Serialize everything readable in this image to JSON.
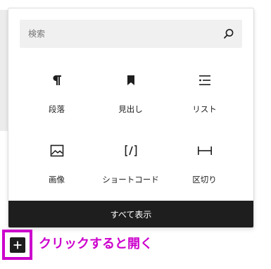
{
  "search": {
    "placeholder": "検索",
    "icon": "search-icon"
  },
  "blocks": [
    {
      "label": "段落",
      "icon": "paragraph-icon"
    },
    {
      "label": "見出し",
      "icon": "bookmark-icon"
    },
    {
      "label": "リスト",
      "icon": "list-icon"
    },
    {
      "label": "画像",
      "icon": "image-icon"
    },
    {
      "label": "ショートコード",
      "icon": "shortcode-icon"
    },
    {
      "label": "区切り",
      "icon": "separator-icon"
    }
  ],
  "footer": {
    "browse_all_label": "すべて表示"
  },
  "add_block": {
    "icon": "plus-icon",
    "highlight_color": "#cc00cc"
  },
  "annotation": {
    "text": "クリックすると開く"
  }
}
